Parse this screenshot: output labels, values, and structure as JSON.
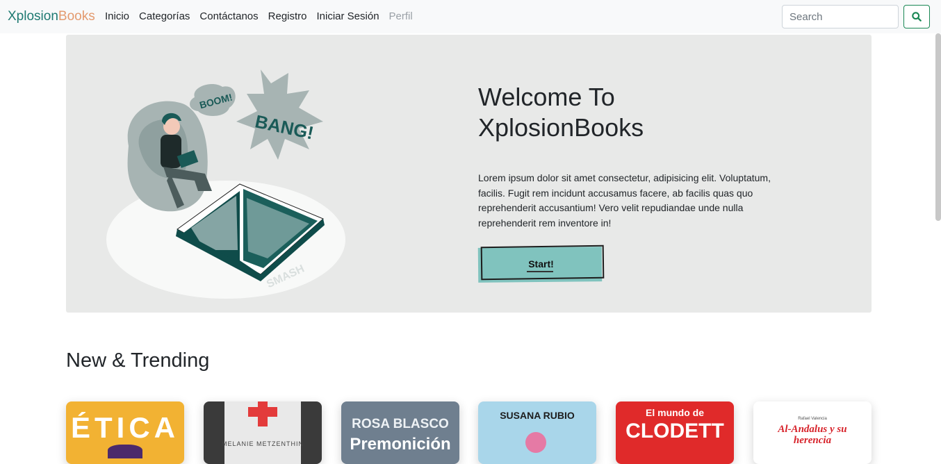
{
  "nav": {
    "brand_part1": "Xplosion",
    "brand_part2": "Books",
    "links": [
      "Inicio",
      "Categorías",
      "Contáctanos",
      "Registro",
      "Iniciar Sesión",
      "Perfil"
    ],
    "search_placeholder": "Search"
  },
  "hero": {
    "title": "Welcome To XplosionBooks",
    "text": "Lorem ipsum dolor sit amet consectetur, adipisicing elit. Voluptatum, facilis. Fugit rem incidunt accusamus facere, ab facilis quas quo reprehenderit accusantium! Vero velit repudiandae unde nulla reprehenderit rem inventore in!",
    "button": "Start!",
    "illustration_words": [
      "BOOM!",
      "BANG!",
      "SMASH"
    ]
  },
  "trending": {
    "title": "New & Trending",
    "books": [
      {
        "cover_text": "ÉTICA",
        "bg": "#f2b233"
      },
      {
        "cover_text": "MELANIE METZENTHIN",
        "bg": "#3a3a3a"
      },
      {
        "cover_text": "ROSA BLASCO",
        "subtext": "Premonición",
        "bg": "#6f7f8f"
      },
      {
        "cover_text": "SUSANA RUBIO",
        "bg": "#a9d6ea"
      },
      {
        "cover_text": "El mundo de",
        "subtext": "CLODETT",
        "bg": "#e02a2a"
      },
      {
        "cover_text": "Rafael Valencia",
        "subtext": "Al-Andalus y su herencia",
        "bg": "#ffffff"
      }
    ]
  },
  "colors": {
    "brand_teal": "#1f7a72",
    "brand_orange": "#e39a6f",
    "button_teal": "#80c3be",
    "search_green": "#198754"
  }
}
